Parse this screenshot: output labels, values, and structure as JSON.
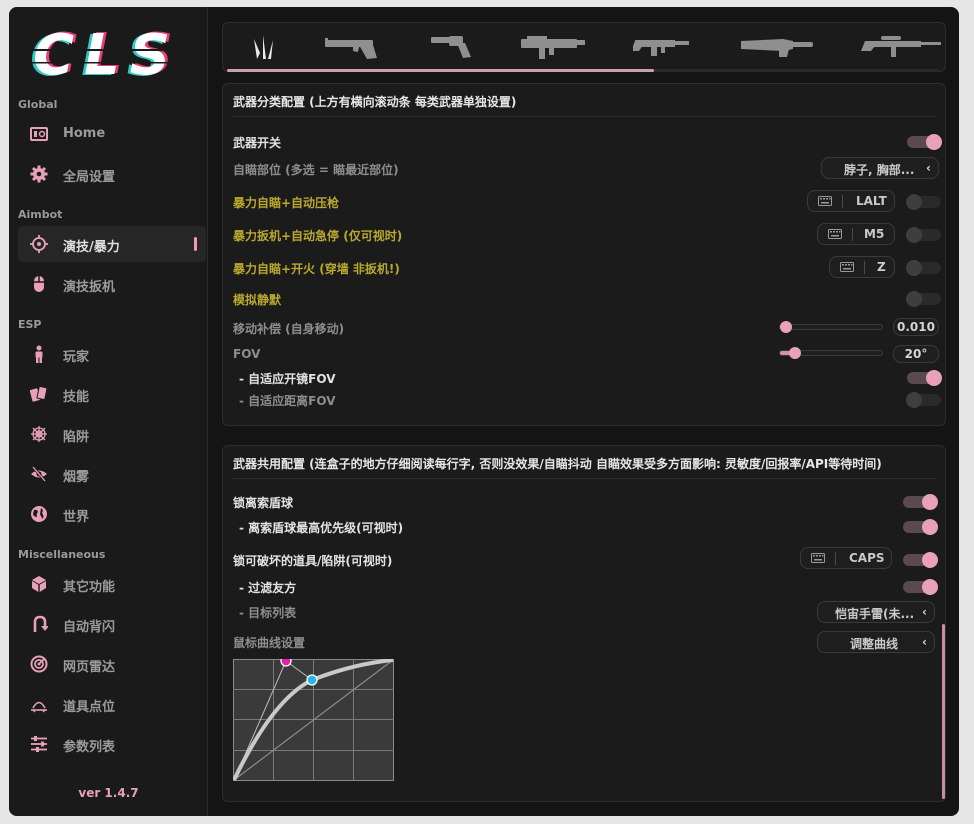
{
  "app": {
    "logo_text": "CLS",
    "version": "ver 1.4.7"
  },
  "sidebar": {
    "sections": [
      {
        "title": "Global",
        "items": [
          {
            "label": "Home",
            "icon": "home-icon"
          },
          {
            "label": "全局设置",
            "icon": "gear-icon"
          }
        ]
      },
      {
        "title": "Aimbot",
        "items": [
          {
            "label": "演技/暴力",
            "icon": "crosshair-icon",
            "active": true
          },
          {
            "label": "演技扳机",
            "icon": "mouse-icon"
          }
        ]
      },
      {
        "title": "ESP",
        "items": [
          {
            "label": "玩家",
            "icon": "person-icon"
          },
          {
            "label": "技能",
            "icon": "cards-icon"
          },
          {
            "label": "陷阱",
            "icon": "spiderweb-icon"
          },
          {
            "label": "烟雾",
            "icon": "eye-slash-icon"
          },
          {
            "label": "世界",
            "icon": "globe-icon"
          }
        ]
      },
      {
        "title": "Miscellaneous",
        "items": [
          {
            "label": "其它功能",
            "icon": "cube-icon"
          },
          {
            "label": "自动背闪",
            "icon": "u-turn-icon"
          },
          {
            "label": "网页雷达",
            "icon": "radar-icon"
          },
          {
            "label": "道具点位",
            "icon": "map-marker-icon"
          },
          {
            "label": "参数列表",
            "icon": "sliders-icon"
          }
        ]
      }
    ]
  },
  "weapons": {
    "tabs": [
      "knife-claw-icon",
      "pistol-icon",
      "revolver-icon",
      "smg-icon",
      "rifle-icon",
      "shotgun-icon",
      "sniper-icon"
    ],
    "scroll_progress": 0.6
  },
  "weapon_panel": {
    "title": "武器分类配置 (上方有横向滚动条 每类武器单独设置)",
    "weapon_switch": {
      "label": "武器开关",
      "on": true
    },
    "aim_part": {
      "label": "自瞄部位 (多选 = 瞄最近部位)",
      "value": "脖子, 胸部..."
    },
    "rage_aim_rcs": {
      "label": "暴力自瞄+自动压枪",
      "key": "LALT",
      "on": false
    },
    "rage_trigger_stop": {
      "label": "暴力扳机+自动急停 (仅可视时)",
      "key": "M5",
      "on": false
    },
    "rage_aim_fire": {
      "label": "暴力自瞄+开火 (穿墙 非扳机!)",
      "key": "Z",
      "on": false
    },
    "simulate_silent": {
      "label": "模拟静默",
      "on": false
    },
    "move_comp": {
      "label": "移动补偿 (自身移动)",
      "value": "0.010",
      "level": 0
    },
    "fov": {
      "label": "FOV",
      "value": "20°",
      "level": 0.1
    },
    "adaptive_scope_fov": {
      "label": "- 自适应开镜FOV",
      "on": true
    },
    "adaptive_dist_fov": {
      "label": "- 自适应距离FOV",
      "on": false
    }
  },
  "shared_panel": {
    "title": "武器共用配置 (连盒子的地方仔细阅读每行字, 否则没效果/自瞄抖动  自瞄效果受多方面影响: 灵敏度/回报率/API等待时间)",
    "lock_orb": {
      "label": "锁离索盾球",
      "on": true
    },
    "orb_priority": {
      "label": "- 离索盾球最高优先级(可视时)",
      "on": true
    },
    "lock_breakables": {
      "label": "锁可破坏的道具/陷阱(可视时)",
      "key": "CAPS",
      "on": true
    },
    "filter_teammates": {
      "label": "- 过滤友方",
      "on": true
    },
    "target_list": {
      "label": "- 目标列表",
      "value": "恺宙手雷(未..."
    },
    "mouse_curve": {
      "label": "鼠标曲线设置",
      "button": "调整曲线"
    }
  },
  "colors": {
    "accent": "#e9a0b9",
    "yellow_label": "#b9a82e",
    "curve_handle_1": "#e61fa8",
    "curve_handle_2": "#2ab6e6"
  }
}
